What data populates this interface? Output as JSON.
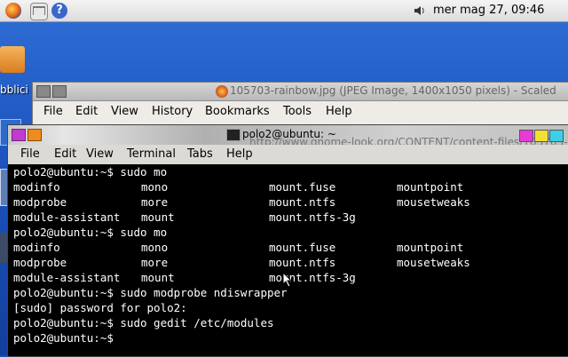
{
  "panel": {
    "clock": "mer mag 27, 09:46",
    "icons": [
      "firefox-icon",
      "mail-icon",
      "help-icon",
      "volume-icon"
    ]
  },
  "desktop": {
    "folder_label": "bblici"
  },
  "firefox": {
    "title": "105703-rainbow.jpg (JPEG Image, 1400x1050 pixels) - Scaled",
    "menu": [
      "File",
      "Edit",
      "View",
      "History",
      "Bookmarks",
      "Tools",
      "Help"
    ],
    "url": "http://www.gnome-look.org/CONTENT/content-files/105703-"
  },
  "terminal": {
    "title": "polo2@ubuntu: ~",
    "menu": [
      "File",
      "Edit",
      "View",
      "Terminal",
      "Tabs",
      "Help"
    ],
    "lines": [
      {
        "type": "text",
        "text": "polo2@ubuntu:~$ sudo mo"
      },
      {
        "type": "cols",
        "cols": [
          "modinfo",
          "mono",
          "mount.fuse",
          "mountpoint"
        ]
      },
      {
        "type": "cols",
        "cols": [
          "modprobe",
          "more",
          "mount.ntfs",
          "mousetweaks"
        ]
      },
      {
        "type": "cols",
        "cols": [
          "module-assistant",
          "mount",
          "mount.ntfs-3g",
          ""
        ]
      },
      {
        "type": "text",
        "text": "polo2@ubuntu:~$ sudo mo"
      },
      {
        "type": "cols",
        "cols": [
          "modinfo",
          "mono",
          "mount.fuse",
          "mountpoint"
        ]
      },
      {
        "type": "cols",
        "cols": [
          "modprobe",
          "more",
          "mount.ntfs",
          "mousetweaks"
        ]
      },
      {
        "type": "cols",
        "cols": [
          "module-assistant",
          "mount",
          "mount.ntfs-3g",
          ""
        ]
      },
      {
        "type": "text",
        "text": "polo2@ubuntu:~$ sudo modprobe ndiswrapper"
      },
      {
        "type": "text",
        "text": "[sudo] password for polo2:"
      },
      {
        "type": "text",
        "text": "polo2@ubuntu:~$ sudo gedit /etc/modules"
      },
      {
        "type": "text",
        "text": "polo2@ubuntu:~$"
      }
    ]
  },
  "colors": {
    "terminal_bg": "#000000",
    "terminal_fg": "#ffffff",
    "desktop_blue": "#1e56c0"
  }
}
